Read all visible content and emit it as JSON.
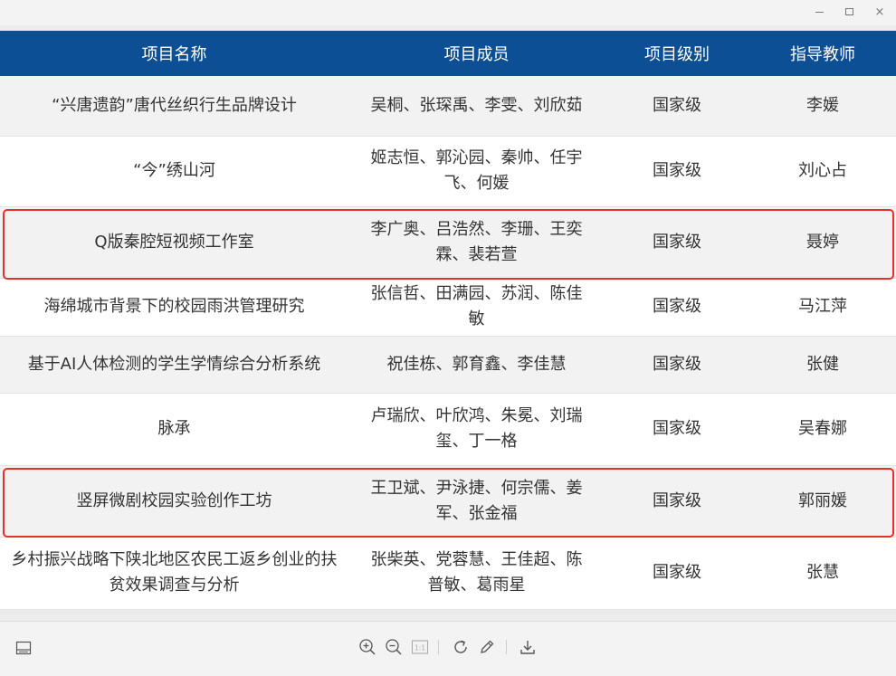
{
  "window": {
    "minimize_icon": "minimize-icon",
    "maximize_icon": "maximize-icon",
    "close_icon": "close-icon",
    "close_glyph": "×"
  },
  "table": {
    "headers": [
      "项目名称",
      "项目成员",
      "项目级别",
      "指导教师"
    ],
    "rows": [
      {
        "name": "“兴唐遗韵”唐代丝织行生品牌设计",
        "members": "吴桐、张琛禹、李雯、刘欣茹",
        "level": "国家级",
        "advisor": "李媛"
      },
      {
        "name": "“今”绣山河",
        "members": "姬志恒、郭沁园、秦帅、任宇飞、何媛",
        "level": "国家级",
        "advisor": "刘心占"
      },
      {
        "name": "Q版秦腔短视频工作室",
        "members": "李广奥、吕浩然、李珊、王奕霖、裴若萱",
        "level": "国家级",
        "advisor": "聂婷"
      },
      {
        "name": "海绵城市背景下的校园雨洪管理研究",
        "members": "张信哲、田满园、苏润、陈佳敏",
        "level": "国家级",
        "advisor": "马江萍"
      },
      {
        "name": "基于AI人体检测的学生学情综合分析系统",
        "members": "祝佳栋、郭育鑫、李佳慧",
        "level": "国家级",
        "advisor": "张健"
      },
      {
        "name": "脉承",
        "members": "卢瑞欣、叶欣鸿、朱冕、刘瑞玺、丁一格",
        "level": "国家级",
        "advisor": "吴春娜"
      },
      {
        "name": "竖屏微剧校园实验创作工坊",
        "members": "王卫斌、尹泳捷、何宗儒、姜军、张金福",
        "level": "国家级",
        "advisor": "郭丽媛"
      },
      {
        "name": "乡村振兴战略下陕北地区农民工返乡创业的扶贫效果调查与分析",
        "members": "张柴英、党蓉慧、王佳超、陈普敏、葛雨星",
        "level": "国家级",
        "advisor": "张慧"
      }
    ]
  },
  "toolbar": {
    "icons": [
      "thumbnail-panel-icon",
      "zoom-in-icon",
      "zoom-out-icon",
      "page-fit-icon",
      "rotate-icon",
      "edit-icon",
      "download-icon"
    ],
    "page_glyph": "1:1"
  },
  "colors": {
    "header_bg": "#0c4f95",
    "highlight_border": "#e8302a"
  }
}
